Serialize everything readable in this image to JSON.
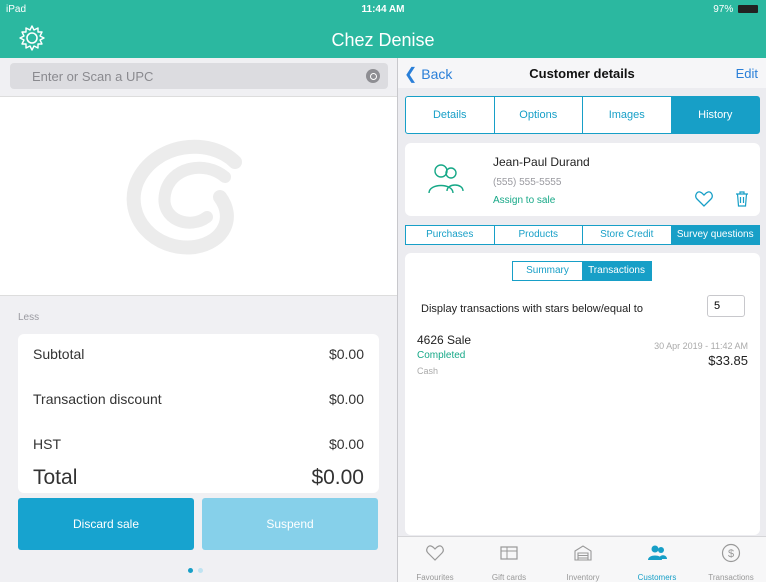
{
  "status_bar": {
    "device": "iPad",
    "time": "11:44 AM",
    "battery": "97%"
  },
  "header": {
    "title": "Chez Denise",
    "settings_icon": "gear-icon"
  },
  "left": {
    "search": {
      "placeholder": "Enter or Scan a UPC"
    },
    "less_label": "Less",
    "totals": [
      {
        "label": "Subtotal",
        "value": "$0.00"
      },
      {
        "label": "Transaction discount",
        "value": "$0.00"
      },
      {
        "label": "HST",
        "value": "$0.00"
      },
      {
        "label": "Total",
        "value": "$0.00"
      }
    ],
    "buttons": {
      "discard": "Discard sale",
      "suspend": "Suspend"
    }
  },
  "right": {
    "nav": {
      "back": "Back",
      "title": "Customer details",
      "edit": "Edit"
    },
    "main_tabs": [
      "Details",
      "Options",
      "Images",
      "History"
    ],
    "main_tabs_active": "History",
    "customer": {
      "name": "Jean-Paul Durand",
      "phone": "(555) 555-5555",
      "assign": "Assign to sale"
    },
    "sub_tabs": [
      "Purchases",
      "Products",
      "Store Credit",
      "Survey questions"
    ],
    "sub_tabs_active": "Survey questions",
    "view_toggle": [
      "Summary",
      "Transactions"
    ],
    "view_toggle_active": "Transactions",
    "filter": {
      "label": "Display transactions with stars below/equal to",
      "value": "5"
    },
    "transactions": [
      {
        "title": "4626 Sale",
        "status": "Completed",
        "method": "Cash",
        "date": "30 Apr 2019 - 11:42 AM",
        "amount": "$33.85"
      }
    ]
  },
  "tabbar": [
    {
      "label": "Favourites",
      "icon": "heart-icon"
    },
    {
      "label": "Gift cards",
      "icon": "gift-card-icon"
    },
    {
      "label": "Inventory",
      "icon": "warehouse-icon"
    },
    {
      "label": "Customers",
      "icon": "customers-icon"
    },
    {
      "label": "Transactions",
      "icon": "dollar-icon"
    }
  ],
  "tabbar_active": "Customers",
  "colors": {
    "brand": "#2bb8a0",
    "accent": "#179fc7",
    "success": "#16a887",
    "discard": "#17a3cf",
    "suspend": "#86d0ea"
  }
}
